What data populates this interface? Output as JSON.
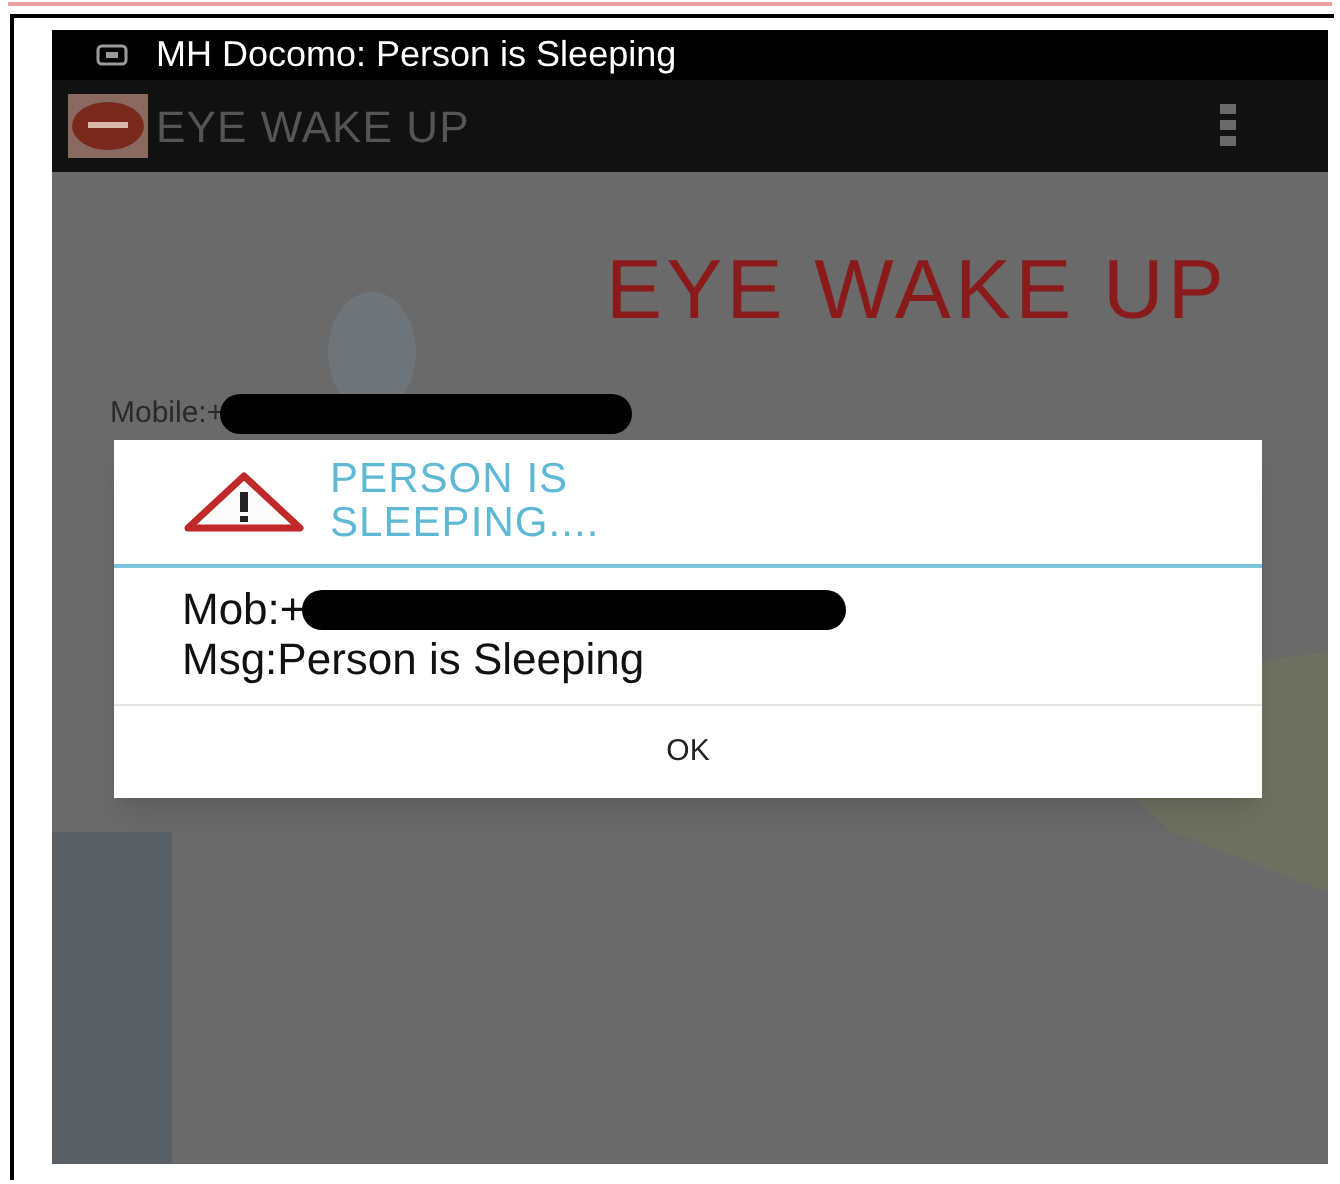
{
  "status_bar": {
    "notification": "MH Docomo: Person is Sleeping"
  },
  "app_bar": {
    "title": "EYE WAKE UP"
  },
  "screen": {
    "heading": "EYE WAKE UP",
    "mobile": {
      "text": "Mobile:+",
      "redacted": true
    }
  },
  "dialog": {
    "title": "PERSON IS SLEEPING....",
    "lines": [
      {
        "text": "Mob:+",
        "redacted": true
      },
      {
        "text": "Msg:Person is Sleeping",
        "redacted": false
      }
    ],
    "button": "OK"
  }
}
